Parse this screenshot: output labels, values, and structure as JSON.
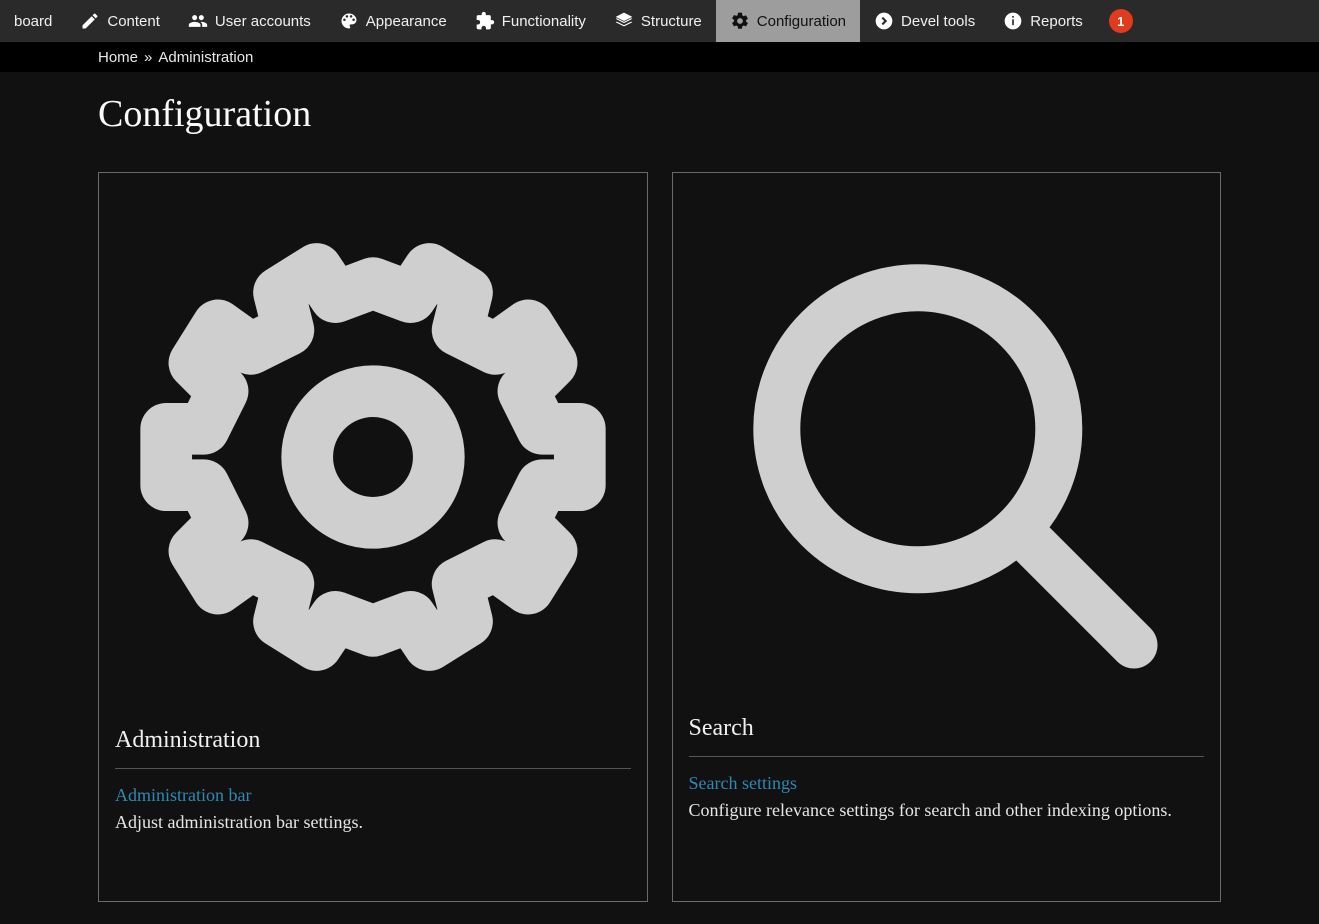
{
  "menu": {
    "items": [
      {
        "label": "board"
      },
      {
        "label": "Content"
      },
      {
        "label": "User accounts"
      },
      {
        "label": "Appearance"
      },
      {
        "label": "Functionality"
      },
      {
        "label": "Structure"
      },
      {
        "label": "Configuration"
      },
      {
        "label": "Devel tools"
      },
      {
        "label": "Reports"
      }
    ],
    "badge": "1"
  },
  "breadcrumb": {
    "home": "Home",
    "sep": "»",
    "current": "Administration"
  },
  "page": {
    "title": "Configuration"
  },
  "panels": {
    "admin": {
      "heading": "Administration",
      "link": "Administration bar",
      "desc": "Adjust administration bar settings."
    },
    "search": {
      "heading": "Search",
      "link": "Search settings",
      "desc": "Configure relevance settings for search and other indexing options."
    }
  }
}
